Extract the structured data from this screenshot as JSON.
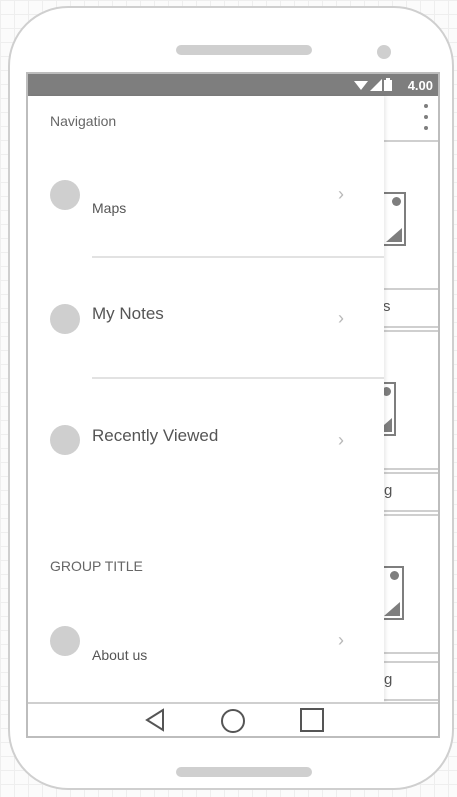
{
  "status_bar": {
    "time": "4.00",
    "icons": [
      "wifi-icon",
      "signal-icon",
      "battery-icon"
    ]
  },
  "drawer": {
    "header": "Navigation",
    "items": [
      {
        "label": "Maps",
        "icon": "avatar-circle",
        "chevron": "›"
      },
      {
        "label": "My Notes",
        "icon": "avatar-circle",
        "chevron": "›"
      },
      {
        "label": "Recently Viewed",
        "icon": "avatar-circle",
        "chevron": "›"
      }
    ],
    "group_title": "GROUP TITLE",
    "group_items": [
      {
        "label": "About us",
        "icon": "avatar-circle",
        "chevron": "›"
      }
    ]
  },
  "background": {
    "button_1_label": "s",
    "button_2_label": "g",
    "button_3_label": "g"
  },
  "soft_nav": [
    "back-icon",
    "home-icon",
    "recents-icon"
  ],
  "colors": {
    "status_bar": "#7e7e7e",
    "placeholder": "#cfcfcf",
    "text": "#555555"
  }
}
